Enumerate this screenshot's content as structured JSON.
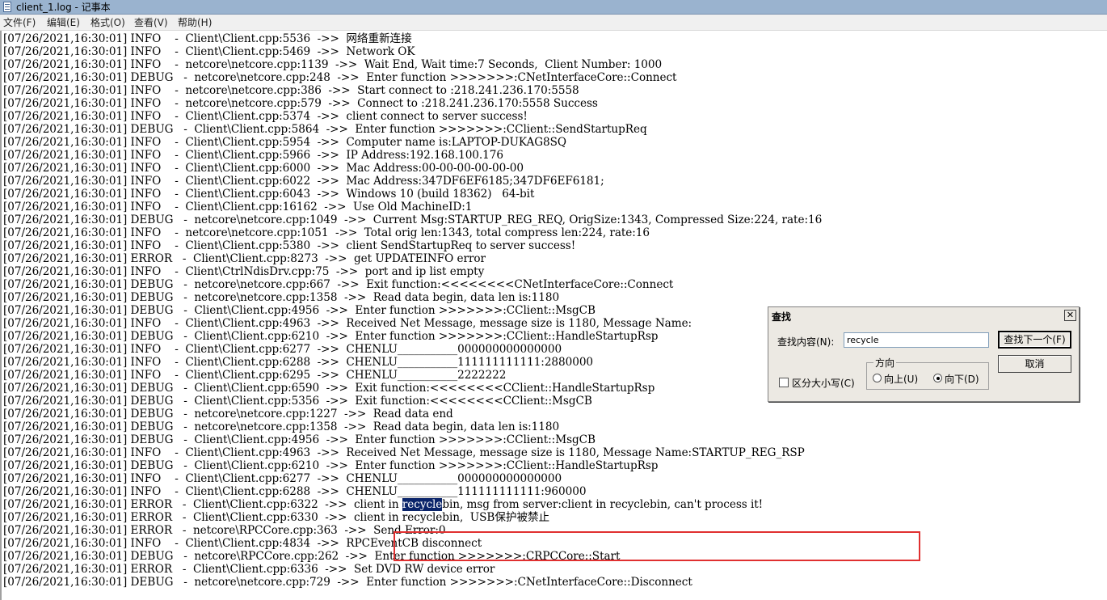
{
  "window": {
    "title": "client_1.log - 记事本"
  },
  "menu": [
    "文件(F)",
    "编辑(E)",
    "格式(O)",
    "查看(V)",
    "帮助(H)"
  ],
  "lines": [
    "[07/26/2021,16:30:01] INFO    -  Client\\Client.cpp:5536  ->>  网络重新连接",
    "[07/26/2021,16:30:01] INFO    -  Client\\Client.cpp:5469  ->>  Network OK",
    "[07/26/2021,16:30:01] INFO    -  netcore\\netcore.cpp:1139  ->>  Wait End, Wait time:7 Seconds,  Client Number: 1000",
    "[07/26/2021,16:30:01] DEBUG   -  netcore\\netcore.cpp:248  ->>  Enter function >>>>>>>:CNetInterfaceCore::Connect",
    "[07/26/2021,16:30:01] INFO    -  netcore\\netcore.cpp:386  ->>  Start connect to :218.241.236.170:5558",
    "[07/26/2021,16:30:01] INFO    -  netcore\\netcore.cpp:579  ->>  Connect to :218.241.236.170:5558 Success",
    "[07/26/2021,16:30:01] INFO    -  Client\\Client.cpp:5374  ->>  client connect to server success!",
    "[07/26/2021,16:30:01] DEBUG   -  Client\\Client.cpp:5864  ->>  Enter function >>>>>>>:CClient::SendStartupReq",
    "[07/26/2021,16:30:01] INFO    -  Client\\Client.cpp:5954  ->>  Computer name is:LAPTOP-DUKAG8SQ",
    "[07/26/2021,16:30:01] INFO    -  Client\\Client.cpp:5966  ->>  IP Address:192.168.100.176",
    "[07/26/2021,16:30:01] INFO    -  Client\\Client.cpp:6000  ->>  Mac Address:00-00-00-00-00-00",
    "[07/26/2021,16:30:01] INFO    -  Client\\Client.cpp:6022  ->>  Mac Address:347DF6EF6185;347DF6EF6181;",
    "[07/26/2021,16:30:01] INFO    -  Client\\Client.cpp:6043  ->>  Windows 10 (build 18362)   64-bit",
    "[07/26/2021,16:30:01] INFO    -  Client\\Client.cpp:16162  ->>  Use Old MachineID:1",
    "[07/26/2021,16:30:01] DEBUG   -  netcore\\netcore.cpp:1049  ->>  Current Msg:STARTUP_REG_REQ, OrigSize:1343, Compressed Size:224, rate:16",
    "[07/26/2021,16:30:01] INFO    -  netcore\\netcore.cpp:1051  ->>  Total orig len:1343, total compress len:224, rate:16",
    "[07/26/2021,16:30:01] INFO    -  Client\\Client.cpp:5380  ->>  client SendStartupReq to server success!",
    "[07/26/2021,16:30:01] ERROR   -  Client\\Client.cpp:8273  ->>  get UPDATEINFO error",
    "[07/26/2021,16:30:01] INFO    -  Client\\CtrlNdisDrv.cpp:75  ->>  port and ip list empty",
    "[07/26/2021,16:30:01] DEBUG   -  netcore\\netcore.cpp:667  ->>  Exit function:<<<<<<<<CNetInterfaceCore::Connect",
    "[07/26/2021,16:30:01] DEBUG   -  netcore\\netcore.cpp:1358  ->>  Read data begin, data len is:1180",
    "[07/26/2021,16:30:01] DEBUG   -  Client\\Client.cpp:4956  ->>  Enter function >>>>>>>:CClient::MsgCB",
    "[07/26/2021,16:30:01] INFO    -  Client\\Client.cpp:4963  ->>  Received Net Message, message size is 1180, Message Name:",
    "[07/26/2021,16:30:01] DEBUG   -  Client\\Client.cpp:6210  ->>  Enter function >>>>>>>:CClient::HandleStartupRsp",
    "[07/26/2021,16:30:01] INFO    -  Client\\Client.cpp:6277  ->>  CHENLU___________000000000000000",
    "[07/26/2021,16:30:01] INFO    -  Client\\Client.cpp:6288  ->>  CHENLU___________111111111111:2880000",
    "[07/26/2021,16:30:01] INFO    -  Client\\Client.cpp:6295  ->>  CHENLU___________2222222",
    "[07/26/2021,16:30:01] DEBUG   -  Client\\Client.cpp:6590  ->>  Exit function:<<<<<<<<CClient::HandleStartupRsp",
    "[07/26/2021,16:30:01] DEBUG   -  Client\\Client.cpp:5356  ->>  Exit function:<<<<<<<<CClient::MsgCB",
    "[07/26/2021,16:30:01] DEBUG   -  netcore\\netcore.cpp:1227  ->>  Read data end",
    "[07/26/2021,16:30:01] DEBUG   -  netcore\\netcore.cpp:1358  ->>  Read data begin, data len is:1180",
    "[07/26/2021,16:30:01] DEBUG   -  Client\\Client.cpp:4956  ->>  Enter function >>>>>>>:CClient::MsgCB",
    "[07/26/2021,16:30:01] INFO    -  Client\\Client.cpp:4963  ->>  Received Net Message, message size is 1180, Message Name:STARTUP_REG_RSP",
    "[07/26/2021,16:30:01] DEBUG   -  Client\\Client.cpp:6210  ->>  Enter function >>>>>>>:CClient::HandleStartupRsp",
    "[07/26/2021,16:30:01] INFO    -  Client\\Client.cpp:6277  ->>  CHENLU___________000000000000000",
    "[07/26/2021,16:30:01] INFO    -  Client\\Client.cpp:6288  ->>  CHENLU___________111111111111:960000",
    "[07/26/2021,16:30:01] ERROR   -  Client\\Client.cpp:6322  ->>  client in recyclebin, msg from server:client in recyclebin, can't process it!",
    "[07/26/2021,16:30:01] ERROR   -  Client\\Client.cpp:6330  ->>  client in recyclebin,  USB保护被禁止",
    "[07/26/2021,16:30:01] ERROR   -  netcore\\RPCCore.cpp:363  ->>  Send Error:0",
    "[07/26/2021,16:30:01] INFO    -  Client\\Client.cpp:4834  ->>  RPCEventCB disconnect",
    "[07/26/2021,16:30:01] DEBUG   -  netcore\\RPCCore.cpp:262  ->>  Enter function >>>>>>>:CRPCCore::Start",
    "[07/26/2021,16:30:01] ERROR   -  Client\\Client.cpp:6336  ->>  Set DVD RW device error",
    "[07/26/2021,16:30:01] DEBUG   -  netcore\\netcore.cpp:729  ->>  Enter function >>>>>>>:CNetInterfaceCore::Disconnect"
  ],
  "highlight": {
    "line_index": 36,
    "term": "recycle"
  },
  "find_dialog": {
    "title": "查找",
    "close_glyph": "✕",
    "find_label": "查找内容(N):",
    "find_value": "recycle",
    "find_next_label": "查找下一个(F)",
    "cancel_label": "取消",
    "direction_legend": "方向",
    "direction_up": "向上(U)",
    "direction_down": "向下(D)",
    "direction_selected": "down",
    "match_case_label": "区分大小写(C)",
    "match_case": false
  },
  "colors": {
    "highlight_bg": "#0a246a",
    "annotation_border": "#e03030",
    "titlebar": "#9ab3cf"
  },
  "icons": {
    "window": "notepad-document-icon",
    "close": "close-icon"
  }
}
